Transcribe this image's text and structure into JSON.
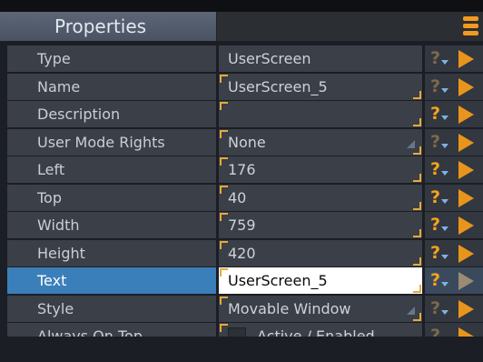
{
  "panel": {
    "title": "Properties"
  },
  "properties": [
    {
      "label": "Type",
      "value": "UserScreen",
      "kind": "text",
      "editable": false,
      "help_active": false
    },
    {
      "label": "Name",
      "value": "UserScreen_5",
      "kind": "text",
      "editable": true,
      "help_active": false
    },
    {
      "label": "Description",
      "value": "",
      "kind": "text",
      "editable": true,
      "help_active": true
    },
    {
      "label": "User Mode Rights",
      "value": "None",
      "kind": "dropdown",
      "editable": true,
      "help_active": false
    },
    {
      "label": "Left",
      "value": "176",
      "kind": "text",
      "editable": true,
      "help_active": true
    },
    {
      "label": "Top",
      "value": "40",
      "kind": "text",
      "editable": true,
      "help_active": true
    },
    {
      "label": "Width",
      "value": "759",
      "kind": "text",
      "editable": true,
      "help_active": true
    },
    {
      "label": "Height",
      "value": "420",
      "kind": "text",
      "editable": true,
      "help_active": true
    },
    {
      "label": "Text",
      "value": "UserScreen_5",
      "kind": "text",
      "editable": true,
      "help_active": true,
      "selected": true
    },
    {
      "label": "Style",
      "value": "Movable Window",
      "kind": "dropdown",
      "editable": true,
      "help_active": false
    },
    {
      "label": "Always On Top",
      "value": "Active / Enabled",
      "kind": "checkbox",
      "checked": false,
      "editable": true,
      "help_active": false
    }
  ],
  "help_glyph": "?",
  "colors": {
    "accent": "#f39a1e",
    "selected_label_bg": "#3b7fba",
    "row_bg": "#3a3f48"
  }
}
